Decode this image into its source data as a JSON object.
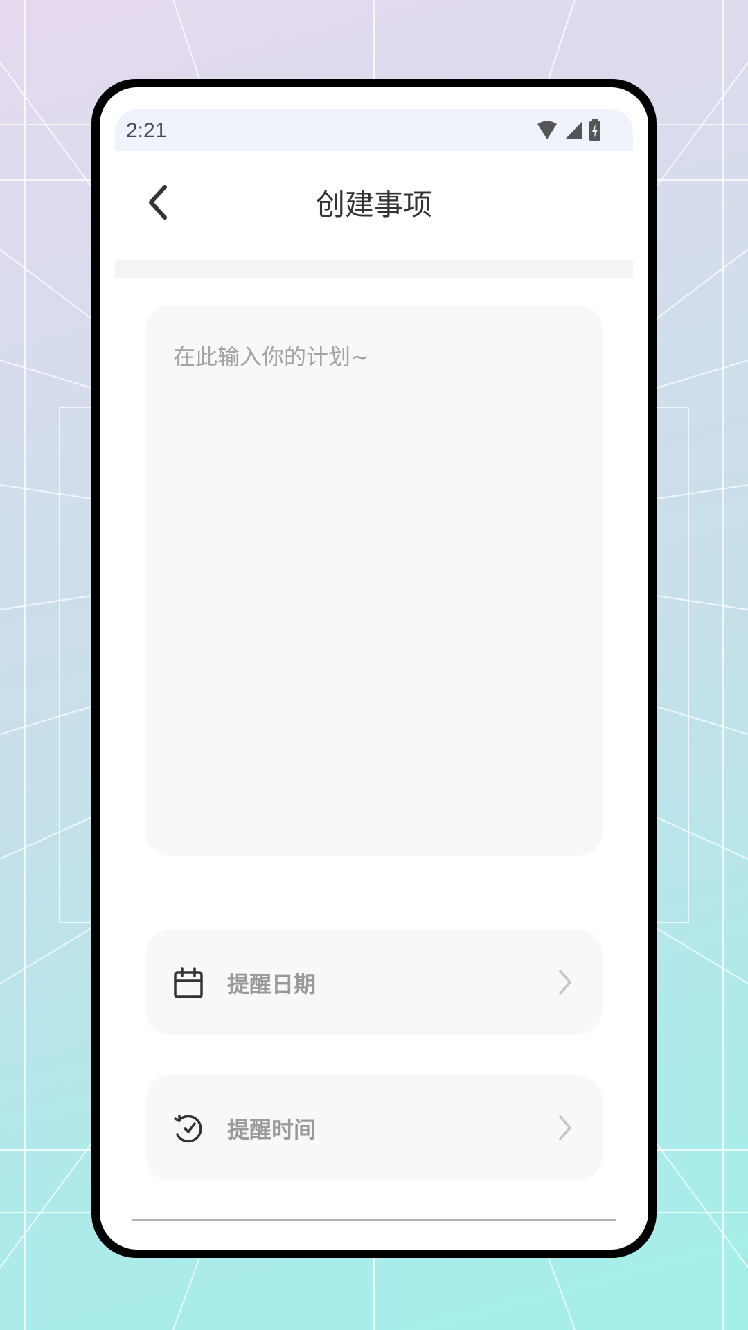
{
  "status_bar": {
    "time": "2:21",
    "icons": [
      "wifi-icon",
      "cell-signal-icon",
      "battery-charging-icon"
    ]
  },
  "header": {
    "title": "创建事项",
    "back_icon": "chevron-left-icon"
  },
  "plan_input": {
    "placeholder": "在此输入你的计划~",
    "value": ""
  },
  "settings": [
    {
      "label": "提醒日期",
      "icon": "calendar-icon",
      "action_icon": "chevron-right-icon"
    },
    {
      "label": "提醒时间",
      "icon": "clock-icon",
      "action_icon": "chevron-right-icon"
    }
  ],
  "colors": {
    "title": "#333333",
    "placeholder": "#a3a3a3",
    "row_label": "#9a9a9a",
    "card_bg": "#f8f8f8",
    "status_bar_bg": "#eef3fc"
  }
}
